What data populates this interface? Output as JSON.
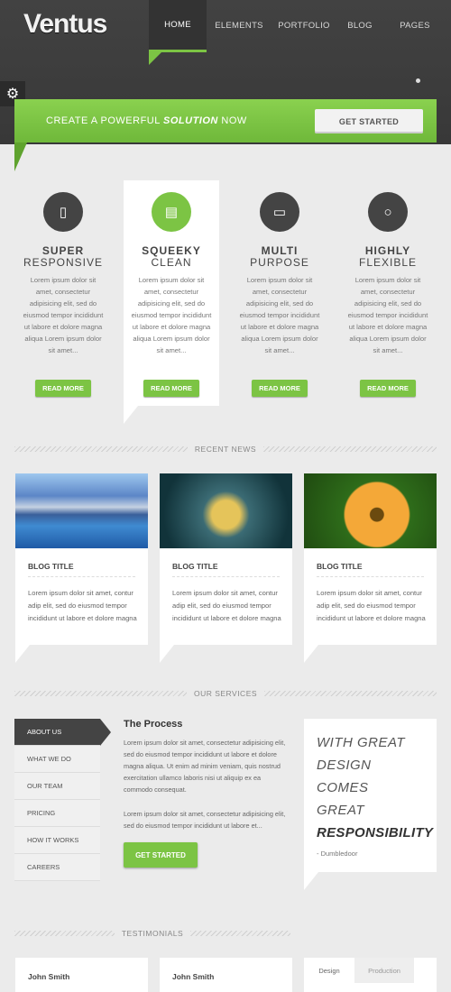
{
  "header": {
    "logo": "Ventus",
    "nav": [
      "HOME",
      "ELEMENTS",
      "PORTFOLIO",
      "BLOG",
      "PAGES"
    ]
  },
  "banner": {
    "text_pre": "CREATE A POWERFUL ",
    "text_em": "SOLUTION",
    "text_post": " NOW",
    "button": "GET STARTED"
  },
  "features": [
    {
      "title_line1": "SUPER",
      "title_line2": "RESPONSIVE",
      "icon": "phone-icon",
      "text": "Lorem ipsum dolor sit amet, consectetur adipisicing elit, sed do eiusmod tempor incididunt ut labore et dolore magna aliqua Lorem ipsum dolor sit amet...",
      "button": "READ MORE"
    },
    {
      "title_line1": "SQUEEKY",
      "title_line2": "CLEAN",
      "icon": "monitor-icon",
      "text": "Lorem ipsum dolor sit amet, consectetur adipisicing elit, sed do eiusmod tempor incididunt ut labore et dolore magna aliqua Lorem ipsum dolor sit amet...",
      "button": "READ MORE"
    },
    {
      "title_line1": "MULTI",
      "title_line2": "PURPOSE",
      "icon": "laptop-icon",
      "text": "Lorem ipsum dolor sit amet, consectetur adipisicing elit, sed do eiusmod tempor incididunt ut labore et dolore magna aliqua Lorem ipsum dolor sit amet...",
      "button": "READ MORE"
    },
    {
      "title_line1": "HIGHLY",
      "title_line2": "FLEXIBLE",
      "icon": "lightbulb-icon",
      "text": "Lorem ipsum dolor sit amet, consectetur adipisicing elit, sed do eiusmod tempor incididunt ut labore et dolore magna aliqua Lorem ipsum dolor sit amet...",
      "button": "READ MORE"
    }
  ],
  "sections": {
    "news": "RECENT NEWS",
    "services": "OUR SERVICES",
    "testimonials": "TESTIMONIALS"
  },
  "blog": [
    {
      "title": "BLOG TITLE",
      "text": "Lorem ipsum dolor sit amet, contur adip elit, sed do eiusmod tempor incididunt ut labore et dolore magna"
    },
    {
      "title": "BLOG TITLE",
      "text": "Lorem ipsum dolor sit amet, contur adip elit, sed do eiusmod tempor incididunt ut labore et dolore magna"
    },
    {
      "title": "BLOG TITLE",
      "text": "Lorem ipsum dolor sit amet, contur adip elit, sed do eiusmod tempor incididunt ut labore et dolore magna"
    }
  ],
  "services": {
    "menu": [
      "ABOUT US",
      "WHAT WE DO",
      "OUR TEAM",
      "PRICING",
      "HOW IT WORKS",
      "CAREERS"
    ],
    "title": "The Process",
    "para1": "Lorem ipsum dolor sit amet, consectetur adipisicing elit, sed do eiusmod tempor incididunt ut labore et dolore magna aliqua. Ut enim ad minim veniam, quis nostrud exercitation ullamco laboris nisi ut aliquip ex ea commodo consequat.",
    "para2": "Lorem ipsum dolor sit amet, consectetur adipisicing elit, sed do eiusmod tempor incididunt ut labore et...",
    "button": "GET STARTED",
    "quote_lines": [
      "WITH GREAT",
      "DESIGN",
      "COMES",
      "GREAT"
    ],
    "quote_strong": "RESPONSIBILITY",
    "quote_author": "- Dumbledoor"
  },
  "testimonials": {
    "names": [
      "John Smith",
      "John Smith"
    ],
    "tabs": [
      "Design",
      "Production"
    ]
  },
  "colors": {
    "accent": "#7cc444",
    "header": "#3b3b3b",
    "background": "#ebebeb"
  }
}
